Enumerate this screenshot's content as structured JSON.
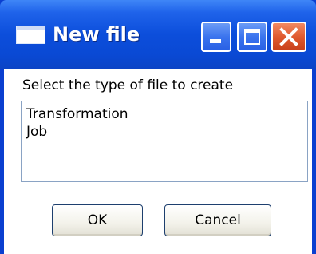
{
  "window": {
    "title": "New file",
    "icon": "window-icon",
    "controls": {
      "minimize_icon": "minimize-icon",
      "maximize_icon": "maximize-icon",
      "close_icon": "close-icon"
    },
    "colors": {
      "titlebar": "#0a49d4",
      "close_button": "#e05a2f",
      "frame": "#0a3fd0"
    }
  },
  "dialog": {
    "prompt": "Select the type of file to create",
    "file_types": [
      "Transformation",
      "Job"
    ],
    "ok_label": "OK",
    "cancel_label": "Cancel"
  }
}
